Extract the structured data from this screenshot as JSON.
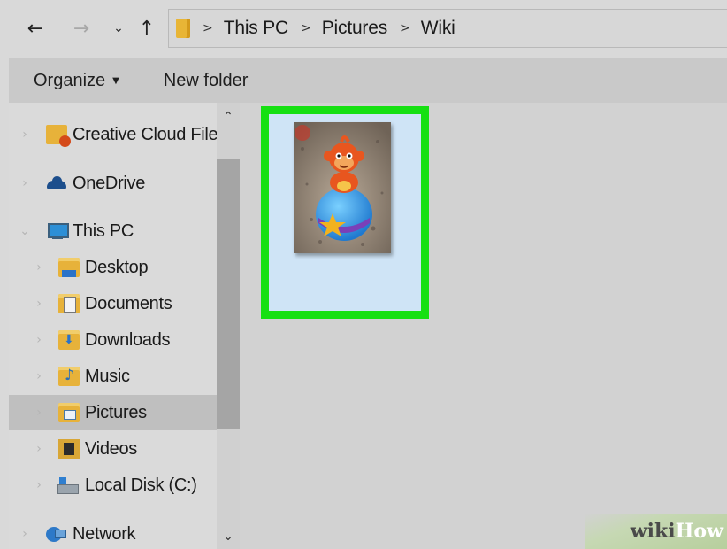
{
  "nav": {
    "back_icon": "arrow-left-icon",
    "forward_icon": "arrow-right-icon",
    "recent_icon": "chevron-down-icon",
    "up_icon": "arrow-up-icon",
    "breadcrumb": [
      "This PC",
      "Pictures",
      "Wiki"
    ]
  },
  "command_bar": {
    "organize_label": "Organize",
    "new_folder_label": "New folder"
  },
  "sidebar": {
    "items": [
      {
        "label": "Creative Cloud Files",
        "icon": "creative-cloud-folder-icon",
        "level": 0,
        "selected": false
      },
      {
        "label": "OneDrive",
        "icon": "onedrive-icon",
        "level": 0,
        "selected": false
      },
      {
        "label": "This PC",
        "icon": "computer-icon",
        "level": 0,
        "expanded": true,
        "selected": false
      },
      {
        "label": "Desktop",
        "icon": "desktop-folder-icon",
        "level": 1,
        "selected": false
      },
      {
        "label": "Documents",
        "icon": "documents-folder-icon",
        "level": 1,
        "selected": false
      },
      {
        "label": "Downloads",
        "icon": "downloads-folder-icon",
        "level": 1,
        "selected": false
      },
      {
        "label": "Music",
        "icon": "music-folder-icon",
        "level": 1,
        "selected": false
      },
      {
        "label": "Pictures",
        "icon": "pictures-folder-icon",
        "level": 1,
        "selected": true
      },
      {
        "label": "Videos",
        "icon": "videos-folder-icon",
        "level": 1,
        "selected": false
      },
      {
        "label": "Local Disk (C:)",
        "icon": "local-disk-icon",
        "level": 1,
        "selected": false
      },
      {
        "label": "Network",
        "icon": "network-icon",
        "level": 0,
        "selected": false
      }
    ]
  },
  "content": {
    "files": [
      {
        "type": "image",
        "thumbnail": "toy-figure-on-ball",
        "selected": true
      }
    ],
    "highlight_color": "#16e012",
    "selection_color": "#cfe4f6"
  },
  "watermark": {
    "part1": "wiki",
    "part2": "How"
  }
}
